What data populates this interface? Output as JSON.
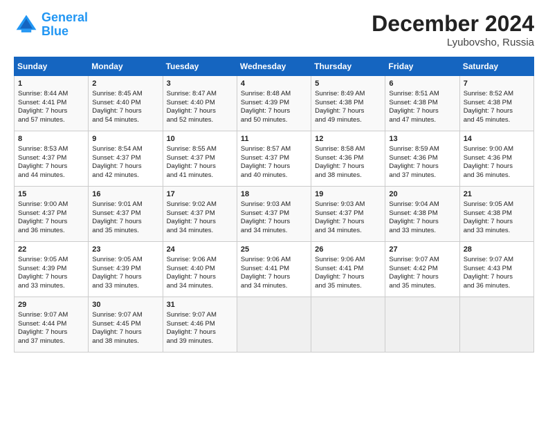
{
  "header": {
    "logo_line1": "General",
    "logo_line2": "Blue",
    "month": "December 2024",
    "location": "Lyubovsho, Russia"
  },
  "days_of_week": [
    "Sunday",
    "Monday",
    "Tuesday",
    "Wednesday",
    "Thursday",
    "Friday",
    "Saturday"
  ],
  "weeks": [
    [
      {
        "day": 1,
        "lines": [
          "Sunrise: 8:44 AM",
          "Sunset: 4:41 PM",
          "Daylight: 7 hours",
          "and 57 minutes."
        ]
      },
      {
        "day": 2,
        "lines": [
          "Sunrise: 8:45 AM",
          "Sunset: 4:40 PM",
          "Daylight: 7 hours",
          "and 54 minutes."
        ]
      },
      {
        "day": 3,
        "lines": [
          "Sunrise: 8:47 AM",
          "Sunset: 4:40 PM",
          "Daylight: 7 hours",
          "and 52 minutes."
        ]
      },
      {
        "day": 4,
        "lines": [
          "Sunrise: 8:48 AM",
          "Sunset: 4:39 PM",
          "Daylight: 7 hours",
          "and 50 minutes."
        ]
      },
      {
        "day": 5,
        "lines": [
          "Sunrise: 8:49 AM",
          "Sunset: 4:38 PM",
          "Daylight: 7 hours",
          "and 49 minutes."
        ]
      },
      {
        "day": 6,
        "lines": [
          "Sunrise: 8:51 AM",
          "Sunset: 4:38 PM",
          "Daylight: 7 hours",
          "and 47 minutes."
        ]
      },
      {
        "day": 7,
        "lines": [
          "Sunrise: 8:52 AM",
          "Sunset: 4:38 PM",
          "Daylight: 7 hours",
          "and 45 minutes."
        ]
      }
    ],
    [
      {
        "day": 8,
        "lines": [
          "Sunrise: 8:53 AM",
          "Sunset: 4:37 PM",
          "Daylight: 7 hours",
          "and 44 minutes."
        ]
      },
      {
        "day": 9,
        "lines": [
          "Sunrise: 8:54 AM",
          "Sunset: 4:37 PM",
          "Daylight: 7 hours",
          "and 42 minutes."
        ]
      },
      {
        "day": 10,
        "lines": [
          "Sunrise: 8:55 AM",
          "Sunset: 4:37 PM",
          "Daylight: 7 hours",
          "and 41 minutes."
        ]
      },
      {
        "day": 11,
        "lines": [
          "Sunrise: 8:57 AM",
          "Sunset: 4:37 PM",
          "Daylight: 7 hours",
          "and 40 minutes."
        ]
      },
      {
        "day": 12,
        "lines": [
          "Sunrise: 8:58 AM",
          "Sunset: 4:36 PM",
          "Daylight: 7 hours",
          "and 38 minutes."
        ]
      },
      {
        "day": 13,
        "lines": [
          "Sunrise: 8:59 AM",
          "Sunset: 4:36 PM",
          "Daylight: 7 hours",
          "and 37 minutes."
        ]
      },
      {
        "day": 14,
        "lines": [
          "Sunrise: 9:00 AM",
          "Sunset: 4:36 PM",
          "Daylight: 7 hours",
          "and 36 minutes."
        ]
      }
    ],
    [
      {
        "day": 15,
        "lines": [
          "Sunrise: 9:00 AM",
          "Sunset: 4:37 PM",
          "Daylight: 7 hours",
          "and 36 minutes."
        ]
      },
      {
        "day": 16,
        "lines": [
          "Sunrise: 9:01 AM",
          "Sunset: 4:37 PM",
          "Daylight: 7 hours",
          "and 35 minutes."
        ]
      },
      {
        "day": 17,
        "lines": [
          "Sunrise: 9:02 AM",
          "Sunset: 4:37 PM",
          "Daylight: 7 hours",
          "and 34 minutes."
        ]
      },
      {
        "day": 18,
        "lines": [
          "Sunrise: 9:03 AM",
          "Sunset: 4:37 PM",
          "Daylight: 7 hours",
          "and 34 minutes."
        ]
      },
      {
        "day": 19,
        "lines": [
          "Sunrise: 9:03 AM",
          "Sunset: 4:37 PM",
          "Daylight: 7 hours",
          "and 34 minutes."
        ]
      },
      {
        "day": 20,
        "lines": [
          "Sunrise: 9:04 AM",
          "Sunset: 4:38 PM",
          "Daylight: 7 hours",
          "and 33 minutes."
        ]
      },
      {
        "day": 21,
        "lines": [
          "Sunrise: 9:05 AM",
          "Sunset: 4:38 PM",
          "Daylight: 7 hours",
          "and 33 minutes."
        ]
      }
    ],
    [
      {
        "day": 22,
        "lines": [
          "Sunrise: 9:05 AM",
          "Sunset: 4:39 PM",
          "Daylight: 7 hours",
          "and 33 minutes."
        ]
      },
      {
        "day": 23,
        "lines": [
          "Sunrise: 9:05 AM",
          "Sunset: 4:39 PM",
          "Daylight: 7 hours",
          "and 33 minutes."
        ]
      },
      {
        "day": 24,
        "lines": [
          "Sunrise: 9:06 AM",
          "Sunset: 4:40 PM",
          "Daylight: 7 hours",
          "and 34 minutes."
        ]
      },
      {
        "day": 25,
        "lines": [
          "Sunrise: 9:06 AM",
          "Sunset: 4:41 PM",
          "Daylight: 7 hours",
          "and 34 minutes."
        ]
      },
      {
        "day": 26,
        "lines": [
          "Sunrise: 9:06 AM",
          "Sunset: 4:41 PM",
          "Daylight: 7 hours",
          "and 35 minutes."
        ]
      },
      {
        "day": 27,
        "lines": [
          "Sunrise: 9:07 AM",
          "Sunset: 4:42 PM",
          "Daylight: 7 hours",
          "and 35 minutes."
        ]
      },
      {
        "day": 28,
        "lines": [
          "Sunrise: 9:07 AM",
          "Sunset: 4:43 PM",
          "Daylight: 7 hours",
          "and 36 minutes."
        ]
      }
    ],
    [
      {
        "day": 29,
        "lines": [
          "Sunrise: 9:07 AM",
          "Sunset: 4:44 PM",
          "Daylight: 7 hours",
          "and 37 minutes."
        ]
      },
      {
        "day": 30,
        "lines": [
          "Sunrise: 9:07 AM",
          "Sunset: 4:45 PM",
          "Daylight: 7 hours",
          "and 38 minutes."
        ]
      },
      {
        "day": 31,
        "lines": [
          "Sunrise: 9:07 AM",
          "Sunset: 4:46 PM",
          "Daylight: 7 hours",
          "and 39 minutes."
        ]
      },
      null,
      null,
      null,
      null
    ]
  ]
}
